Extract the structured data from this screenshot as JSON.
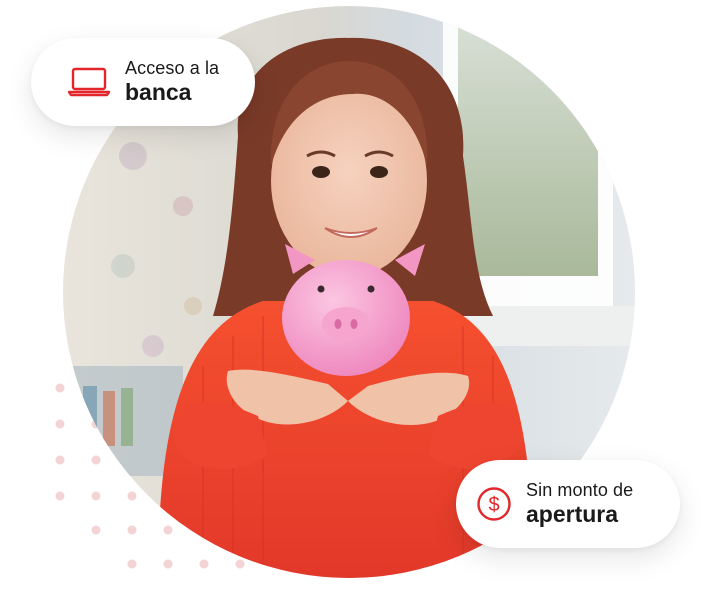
{
  "colors": {
    "accent": "#e3262b",
    "badge_bg": "#ffffff",
    "text": "#1a1a1a",
    "dots": "#f3d3d4",
    "sweater": "#f2442e",
    "piggy": "#f7a6cf"
  },
  "badges": {
    "access": {
      "icon": "laptop-icon",
      "line1": "Acceso a la",
      "line2": "banca"
    },
    "opening": {
      "icon": "dollar-coin-icon",
      "line1": "Sin monto de",
      "line2": "apertura"
    }
  },
  "photo": {
    "subject": "girl-holding-piggy-bank"
  }
}
